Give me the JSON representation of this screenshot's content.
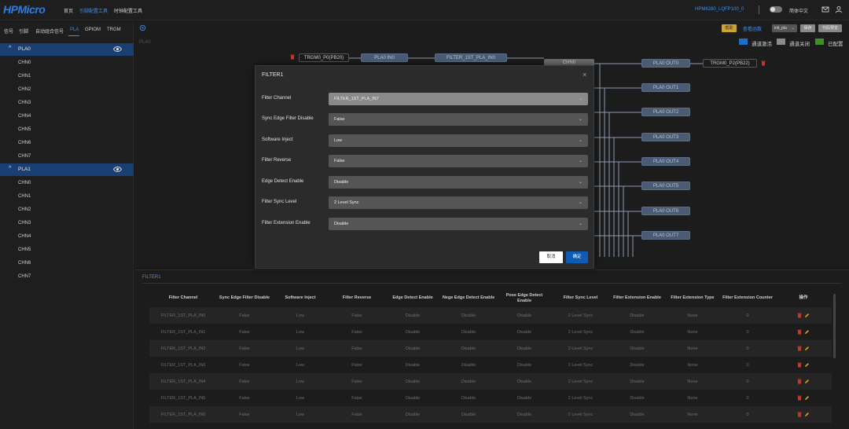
{
  "topbar": {
    "logo": "HPMicro",
    "nav": [
      "首页",
      "引脚配置工具",
      "时钟配置工具"
    ],
    "active_nav": 1,
    "chip": "HPM6280_LQFP100_0",
    "language": "简体中文",
    "icons": [
      "toggle-switch",
      "mail-icon",
      "user-icon"
    ]
  },
  "sidebar": {
    "tabs": [
      "信号",
      "引脚",
      "自动组合信号",
      "PLA",
      "GPIOM",
      "TRGM"
    ],
    "active_tab": "PLA",
    "groups": [
      {
        "label": "PLA0",
        "items": [
          "CHN0",
          "CHN1",
          "CHN2",
          "CHN3",
          "CHN4",
          "CHN5",
          "CHN6",
          "CHN7"
        ]
      },
      {
        "label": "PLA1",
        "items": [
          "CHN0",
          "CHN1",
          "CHN2",
          "CHN3",
          "CHN4",
          "CHN5",
          "CHN6",
          "CHN7"
        ]
      }
    ]
  },
  "canvas": {
    "label": "PLA0",
    "toolbar": {
      "help": "帮助",
      "func_link": "查看函数",
      "select_value": "init_pla",
      "save": "保存",
      "preview": "代码预览"
    },
    "legend": [
      {
        "label": "通道激活",
        "color": "#1f6fc8"
      },
      {
        "label": "通道关闭",
        "color": "#8c8c8c"
      },
      {
        "label": "已配置",
        "color": "#3f8f2a"
      }
    ],
    "nodes": {
      "trgm_in": "TRGM0_P0(PB20)",
      "pla_in0": "PLA0 IN0",
      "filter_in": "FILTER_1ST_PLA_IN0",
      "chn": "CHN0",
      "trgm_out": "TRGM0_P2(PB22)",
      "outputs": [
        "PLA0 OUT0",
        "PLA0 OUT1",
        "PLA0 OUT2",
        "PLA0 OUT3",
        "PLA0 OUT4",
        "PLA0 OUT5",
        "PLA0 OUT6",
        "PLA0 OUT7"
      ]
    }
  },
  "modal": {
    "title": "FILTER1",
    "fields": [
      {
        "label": "Filter Channel",
        "value": "FILTER_1ST_PLA_IN7"
      },
      {
        "label": "Sync Edge Filter Disable",
        "value": "False"
      },
      {
        "label": "Software Inject",
        "value": "Low"
      },
      {
        "label": "Filter Reverse",
        "value": "False"
      },
      {
        "label": "Edge Detect Enable",
        "value": "Disable"
      },
      {
        "label": "Filter Sync Level",
        "value": "2 Level Sync"
      },
      {
        "label": "Filter Extension Enable",
        "value": "Disable"
      }
    ],
    "cancel": "取消",
    "ok": "确定"
  },
  "bottom": {
    "title": "FILTER1",
    "columns": [
      "Filter Channel",
      "Sync Edge Filter Disable",
      "Software Inject",
      "Filter Reverse",
      "Edge Detect Enable",
      "Nege Edge Detect Enable",
      "Pose Edge Detect Enable",
      "Filter Sync Level",
      "Filter Extension Enable",
      "Filter Extension Type",
      "Filter Extension Counter",
      "操作"
    ],
    "rows": [
      [
        "FILTER_1ST_PLA_IN0",
        "False",
        "Low",
        "False",
        "Disable",
        "Disable",
        "Disable",
        "2 Level Sync",
        "Disable",
        "None",
        "0"
      ],
      [
        "FILTER_1ST_PLA_IN1",
        "False",
        "Low",
        "False",
        "Disable",
        "Disable",
        "Disable",
        "2 Level Sync",
        "Disable",
        "None",
        "0"
      ],
      [
        "FILTER_1ST_PLA_IN2",
        "False",
        "Low",
        "False",
        "Disable",
        "Disable",
        "Disable",
        "2 Level Sync",
        "Disable",
        "None",
        "0"
      ],
      [
        "FILTER_1ST_PLA_IN3",
        "False",
        "Low",
        "False",
        "Disable",
        "Disable",
        "Disable",
        "2 Level Sync",
        "Disable",
        "None",
        "0"
      ],
      [
        "FILTER_1ST_PLA_IN4",
        "False",
        "Low",
        "False",
        "Disable",
        "Disable",
        "Disable",
        "2 Level Sync",
        "Disable",
        "None",
        "0"
      ],
      [
        "FILTER_1ST_PLA_IN5",
        "False",
        "Low",
        "False",
        "Disable",
        "Disable",
        "Disable",
        "2 Level Sync",
        "Disable",
        "None",
        "0"
      ],
      [
        "FILTER_1ST_PLA_IN6",
        "False",
        "Low",
        "False",
        "Disable",
        "Disable",
        "Disable",
        "2 Level Sync",
        "Disable",
        "None",
        "0"
      ]
    ]
  }
}
